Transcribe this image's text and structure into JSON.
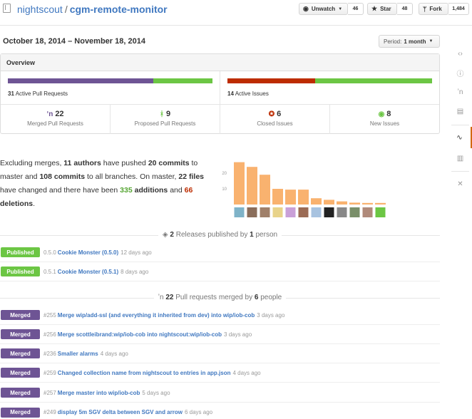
{
  "header": {
    "owner": "nightscout",
    "separator": "/",
    "repo": "cgm-remote-monitor",
    "unwatch_label": "Unwatch",
    "unwatch_count": "46",
    "star_label": "Star",
    "star_count": "48",
    "fork_label": "Fork",
    "fork_count": "1,484"
  },
  "date_range": "October 18, 2014 – November 18, 2014",
  "period": {
    "label": "Period:",
    "value": "1 month"
  },
  "overview": {
    "title": "Overview",
    "pr_bar": {
      "merged_fraction": 0.71,
      "colors": [
        "#6e5494",
        "#6cc644"
      ]
    },
    "issue_bar": {
      "closed_fraction": 0.43,
      "colors": [
        "#bd2c00",
        "#6cc644"
      ]
    },
    "active_prs_count": "31",
    "active_prs_label": "Active Pull Requests",
    "active_issues_count": "14",
    "active_issues_label": "Active Issues",
    "stats": [
      {
        "icon": "merge-icon",
        "glyph": "ʼn",
        "color": "#6e5494",
        "value": "22",
        "label": "Merged Pull Requests"
      },
      {
        "icon": "pull-request-icon",
        "glyph": "ᚼ",
        "color": "#6cc644",
        "value": "9",
        "label": "Proposed Pull Requests"
      },
      {
        "icon": "issue-closed-icon",
        "glyph": "✪",
        "color": "#bd2c00",
        "value": "6",
        "label": "Closed Issues"
      },
      {
        "icon": "issue-opened-icon",
        "glyph": "◉",
        "color": "#6cc644",
        "value": "8",
        "label": "New Issues"
      }
    ]
  },
  "summary": {
    "p1": "Excluding merges,",
    "authors": "11 authors",
    "p2": "have pushed",
    "commits": "20 commits",
    "p3": "to master and",
    "all_commits": "108 commits",
    "p4": "to all branches. On master,",
    "files": "22 files",
    "p5": "have changed and there have been",
    "additions_count": "335",
    "additions_word": "additions",
    "p6": "and",
    "deletions_count": "66",
    "deletions_word": "deletions",
    "p7": "."
  },
  "chart_data": {
    "type": "bar",
    "categories": [
      "1",
      "2",
      "3",
      "4",
      "5",
      "6",
      "7",
      "8",
      "9",
      "10",
      "11",
      "12"
    ],
    "values": [
      27,
      24,
      19,
      10,
      9.5,
      9.5,
      4,
      3,
      2,
      1.2,
      1,
      1
    ],
    "ylim": [
      0,
      30
    ],
    "yticks": [
      "10",
      "20"
    ],
    "color": "#f9b26f",
    "xlabel": "",
    "ylabel": "",
    "title": ""
  },
  "releases": {
    "count": "2",
    "text1": "Releases published by",
    "people": "1",
    "text2": "person",
    "items": [
      {
        "badge": "Published",
        "version": "0.5.0",
        "title": "Cookie Monster (0.5.0)",
        "time": "12 days ago"
      },
      {
        "badge": "Published",
        "version": "0.5.1",
        "title": "Cookie Monster (0.5.1)",
        "time": "8 days ago"
      }
    ]
  },
  "merged": {
    "count": "22",
    "text1": "Pull requests merged by",
    "people": "6",
    "text2": "people",
    "items": [
      {
        "badge": "Merged",
        "num": "#255",
        "title": "Merge wip/add-ssl (and everything it inherited from dev) into wip/iob-cob",
        "time": "3 days ago"
      },
      {
        "badge": "Merged",
        "num": "#256",
        "title": "Merge scottleibrand:wip/iob-cob into nightscout:wip/iob-cob",
        "time": "3 days ago"
      },
      {
        "badge": "Merged",
        "num": "#236",
        "title": "Smaller alarms",
        "time": "4 days ago"
      },
      {
        "badge": "Merged",
        "num": "#259",
        "title": "Changed collection name from nightscout to entries in app.json",
        "time": "4 days ago"
      },
      {
        "badge": "Merged",
        "num": "#257",
        "title": "Merge master into wip/iob-cob",
        "time": "5 days ago"
      },
      {
        "badge": "Merged",
        "num": "#249",
        "title": "display 5m SGV delta between SGV and arrow",
        "time": "6 days ago"
      }
    ]
  },
  "sidebar": {
    "items": [
      {
        "icon": "code-icon",
        "glyph": "‹›"
      },
      {
        "icon": "issues-icon",
        "glyph": "ⓘ"
      },
      {
        "icon": "pull-requests-icon",
        "glyph": "ʼn"
      },
      {
        "icon": "wiki-icon",
        "glyph": "▤"
      },
      {
        "icon": "pulse-icon",
        "glyph": "∿"
      },
      {
        "icon": "graphs-icon",
        "glyph": "▥"
      },
      {
        "icon": "settings-icon",
        "glyph": "✕"
      }
    ]
  }
}
